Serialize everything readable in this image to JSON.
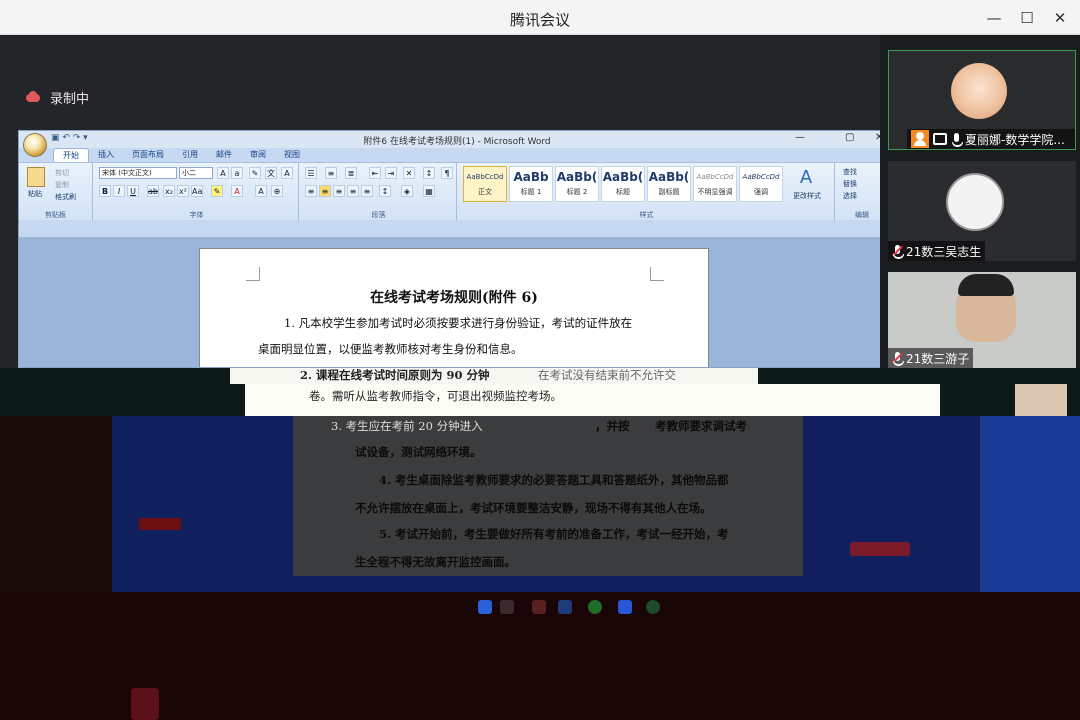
{
  "window": {
    "title": "腾讯会议"
  },
  "recording": {
    "label": "录制中"
  },
  "word": {
    "title": "附件6 在线考试考场规则(1) - Microsoft Word",
    "tabs": [
      "开始",
      "插入",
      "页面布局",
      "引用",
      "邮件",
      "审阅",
      "视图"
    ],
    "font_name": "宋体 (中文正文)",
    "font_size": "小二",
    "groups": {
      "clipboard": "剪贴板",
      "font": "字体",
      "paragraph": "段落",
      "styles": "样式",
      "editing": "编辑"
    },
    "clipboard": {
      "paste": "粘贴",
      "cut": "剪切",
      "copy": "复制",
      "format_painter": "格式刷"
    },
    "styles": [
      {
        "preview": "AaBbCcDd",
        "name": "正文"
      },
      {
        "preview": "AaBb",
        "name": "标题 1"
      },
      {
        "preview": "AaBb(",
        "name": "标题 2"
      },
      {
        "preview": "AaBb(",
        "name": "标题"
      },
      {
        "preview": "AaBb(",
        "name": "副标题"
      },
      {
        "preview": "AaBbCcDd",
        "name": "不明显强调"
      },
      {
        "preview": "AaBbCcDd",
        "name": "强调"
      }
    ],
    "change_styles": "更改样式",
    "editing": {
      "find": "查找",
      "replace": "替换",
      "select": "选择"
    }
  },
  "document": {
    "title": "在线考试考场规则(附件 6)",
    "rule1_line1": "1. 凡本校学生参加考试时必须按要求进行身份验证，考试的证件放在",
    "rule1_line2": "桌面明显位置，以便监考教师核对考生身份和信息。",
    "rule2_line1": "2. 课程在线考试时间原则为 90 分钟",
    "rule2_line1b": "在考试没有结束前不允许交",
    "rule2_line2": "卷。需听从监考教师指令，可退出视频监控考场。",
    "rule3_line1": "3. 考生应在考前 20 分钟进入",
    "rule3_line1b": "，并按",
    "rule3_line1c": "考教师要求调试考",
    "rule3_line2": "试设备，测试网络环境。",
    "rule4_line1": "4. 考生桌面除监考教师要求的必要答题工具和答题纸外，其他物品都",
    "rule4_line2": "不允许摆放在桌面上，考试环境要整洁安静，现场不得有其他人在场。",
    "rule5_line1": "5. 考试开始前，考生要做好所有考前的准备工作，考试一经开始，考",
    "rule5_line2": "生全程不得无故离开监控画面。"
  },
  "participants": [
    {
      "name": "夏丽娜-数学学院...",
      "mic": "on",
      "host": true
    },
    {
      "name": "21数三吴志生",
      "mic": "muted"
    },
    {
      "name": "21数三游子",
      "mic": "muted"
    }
  ],
  "colors": {
    "titlebar": "#f4f4f4",
    "stage": "#232528",
    "record_dot": "#e15a5a",
    "word_ribbon": "#d3e3f6",
    "host_badge": "#f08a24"
  }
}
